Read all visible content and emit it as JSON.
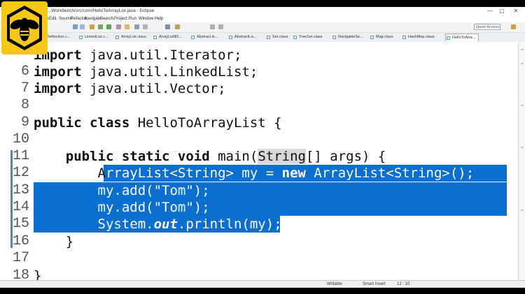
{
  "window": {
    "title": "...Workbench/src/com/HelloToArrayList.java - Eclipse",
    "controls": {
      "minimize": "—",
      "maximize": "▢",
      "close": "✕"
    }
  },
  "menu": [
    "File",
    "Edit",
    "Source",
    "Refactor",
    "Navigate",
    "Search",
    "Project",
    "Run",
    "Window",
    "Help"
  ],
  "quick_access": {
    "placeholder": "Quick Access"
  },
  "tabs": [
    {
      "label": "Reflection.c..."
    },
    {
      "label": "LinkedList.c..."
    },
    {
      "label": "ArrayList.class"
    },
    {
      "label": "ArrayList$S..."
    },
    {
      "label": "Abstract.ls..."
    },
    {
      "label": "AbstractLis..."
    },
    {
      "label": "Set.class"
    },
    {
      "label": "TreeSet.class"
    },
    {
      "label": "NavigableSe..."
    },
    {
      "label": "Map.class"
    },
    {
      "label": "HashMap.class"
    },
    {
      "label": "HelloToArra..."
    }
  ],
  "editor": {
    "lines": [
      {
        "num": "",
        "parts": [
          {
            "t": "import",
            "k": 1
          },
          {
            "t": " java.util.Iterator;"
          }
        ]
      },
      {
        "num": "6",
        "parts": [
          {
            "t": "import",
            "k": 1
          },
          {
            "t": " java.util.LinkedList;"
          }
        ]
      },
      {
        "num": "7",
        "parts": [
          {
            "t": "import",
            "k": 1
          },
          {
            "t": " java.util.Vector;"
          }
        ]
      },
      {
        "num": "8",
        "parts": []
      },
      {
        "num": "9",
        "parts": [
          {
            "t": "public class",
            "k": 1
          },
          {
            "t": " HelloToArrayList {"
          }
        ]
      },
      {
        "num": "10",
        "parts": []
      },
      {
        "num": "11",
        "parts": [
          {
            "t": "    "
          },
          {
            "t": "public static void",
            "k": 1
          },
          {
            "t": " main("
          },
          {
            "t": "String",
            "h": 1
          },
          {
            "t": "[] args) {"
          }
        ]
      },
      {
        "num": "12",
        "parts": [
          {
            "t": "        A"
          },
          {
            "t": "rrayList<String> my = ",
            "s": 1
          },
          {
            "t": "new",
            "k": 1,
            "s": 1
          },
          {
            "t": " ArrayList<String>();",
            "s": 1
          }
        ]
      },
      {
        "num": "13",
        "parts": [
          {
            "t": "        my.add(\"Tom\");",
            "s": 1
          }
        ]
      },
      {
        "num": "14",
        "parts": [
          {
            "t": "        my.add(\"Tom\");",
            "s": 1
          }
        ]
      },
      {
        "num": "15",
        "parts": [
          {
            "t": "        System.",
            "s": 1
          },
          {
            "t": "out",
            "k": 1,
            "i": 1,
            "s": 1
          },
          {
            "t": ".println(my);",
            "s": 1
          }
        ]
      },
      {
        "num": "16",
        "parts": [
          {
            "t": "    }"
          }
        ]
      },
      {
        "num": "17",
        "parts": []
      },
      {
        "num": "18",
        "parts": [
          {
            "t": "}"
          }
        ]
      }
    ]
  },
  "status": {
    "mode": "Writable",
    "insert": "Smart Insert",
    "position": "12 : 10"
  },
  "colors": {
    "selection": "#0a6fd1",
    "logo": "#f7c815"
  }
}
